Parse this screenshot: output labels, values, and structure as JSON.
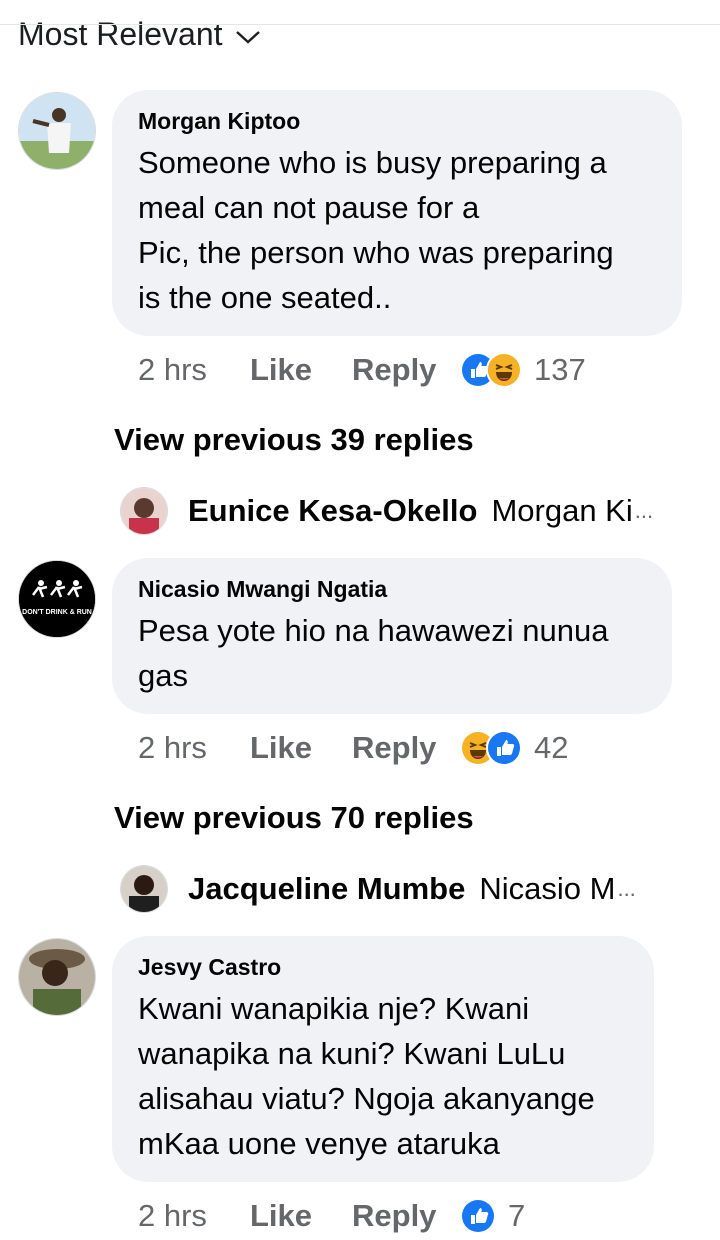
{
  "sort": {
    "label": "Most Relevant"
  },
  "comments": [
    {
      "author": "Morgan Kiptoo",
      "text_lines": [
        "Someone who is busy preparing a",
        "meal can not pause for a",
        "Pic, the person who was preparing",
        "is the one seated.."
      ],
      "time": "2 hrs",
      "like_label": "Like",
      "reply_label": "Reply",
      "reactions": [
        "like",
        "haha"
      ],
      "reaction_count": "137",
      "view_previous": "View previous 39 replies",
      "latest_reply": {
        "author": "Eunice Kesa-Okello",
        "preview": "Morgan Ki",
        "ellipsis": "..."
      }
    },
    {
      "author": "Nicasio Mwangi Ngatia",
      "avatar_text": "DON'T DRINK & RUN",
      "text_lines": [
        "Pesa yote hio na hawawezi nunua",
        "gas"
      ],
      "time": "2 hrs",
      "like_label": "Like",
      "reply_label": "Reply",
      "reactions": [
        "haha",
        "like"
      ],
      "reaction_count": "42",
      "view_previous": "View previous 70 replies",
      "latest_reply": {
        "author": "Jacqueline Mumbe",
        "preview": "Nicasio M",
        "ellipsis": "..."
      }
    },
    {
      "author": "Jesvy Castro",
      "text_lines": [
        "Kwani wanapikia nje? Kwani",
        "wanapika na kuni? Kwani LuLu",
        "alisahau viatu? Ngoja akanyange",
        "mKaa uone venye ataruka"
      ],
      "time": "2 hrs",
      "like_label": "Like",
      "reply_label": "Reply",
      "reactions": [
        "like"
      ],
      "reaction_count": "7"
    }
  ],
  "colors": {
    "like_blue": "#1877f2",
    "haha_yellow": "#f7b125",
    "bubble_gray": "#f0f2f5",
    "meta_gray": "#65676b"
  }
}
